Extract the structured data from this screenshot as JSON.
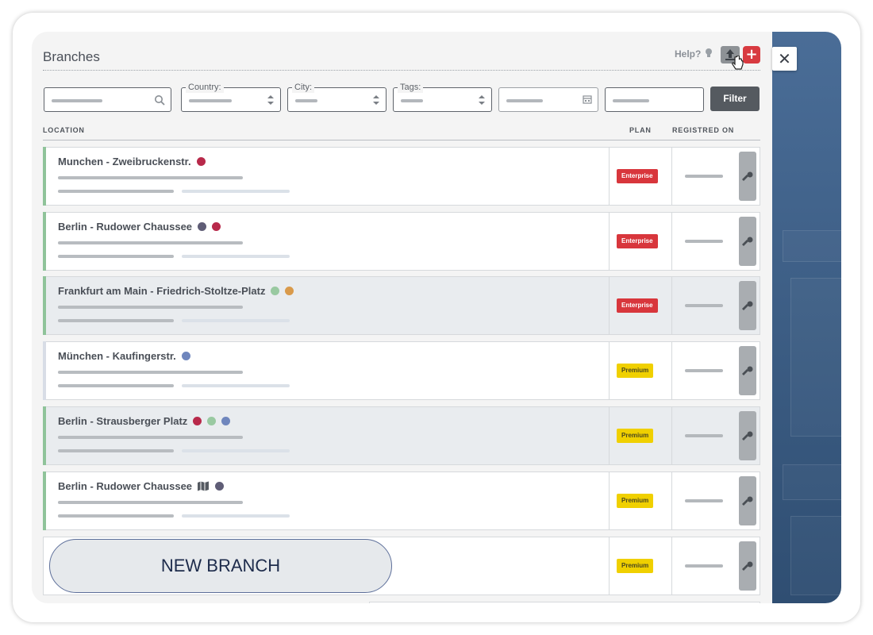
{
  "panel": {
    "title": "Branches",
    "help_label": "Help?",
    "add_label": "+",
    "close_label": "✕"
  },
  "filters": {
    "country_label": "Country:",
    "city_label": "City:",
    "tags_label": "Tags:",
    "filter_button": "Filter"
  },
  "columns": {
    "location": "LOCATION",
    "plan": "PLAN",
    "registered_on": "REGISTRED ON"
  },
  "colors": {
    "crimson": "#b8294a",
    "slate": "#5f5d76",
    "green": "#99c9a1",
    "orange": "#d99a4b",
    "blue": "#6f86bd",
    "enterprise": "#d8363c",
    "premium": "#f0d000",
    "accent_stripe": "#8fc39a"
  },
  "rows": [
    {
      "name": "Munchen - Zweibruckenstr.",
      "plan": "Enterprise",
      "tags": [
        "crimson"
      ]
    },
    {
      "name": "Berlin - Rudower Chaussee",
      "plan": "Enterprise",
      "tags": [
        "slate",
        "crimson"
      ]
    },
    {
      "name": "Frankfurt am Main - Friedrich-Stoltze-Platz",
      "plan": "Enterprise",
      "tags": [
        "green",
        "orange"
      ]
    },
    {
      "name": "München - Kaufingerstr.",
      "plan": "Premium",
      "tags": [
        "blue"
      ]
    },
    {
      "name": "Berlin - Strausberger Platz",
      "plan": "Premium",
      "tags": [
        "crimson",
        "green",
        "blue"
      ]
    },
    {
      "name": "Berlin - Rudower Chaussee",
      "plan": "Premium",
      "tags": [
        "map",
        "slate"
      ]
    },
    {
      "name": "",
      "plan": "Premium",
      "tags": []
    }
  ],
  "new_branch_label": "NEW BRANCH"
}
